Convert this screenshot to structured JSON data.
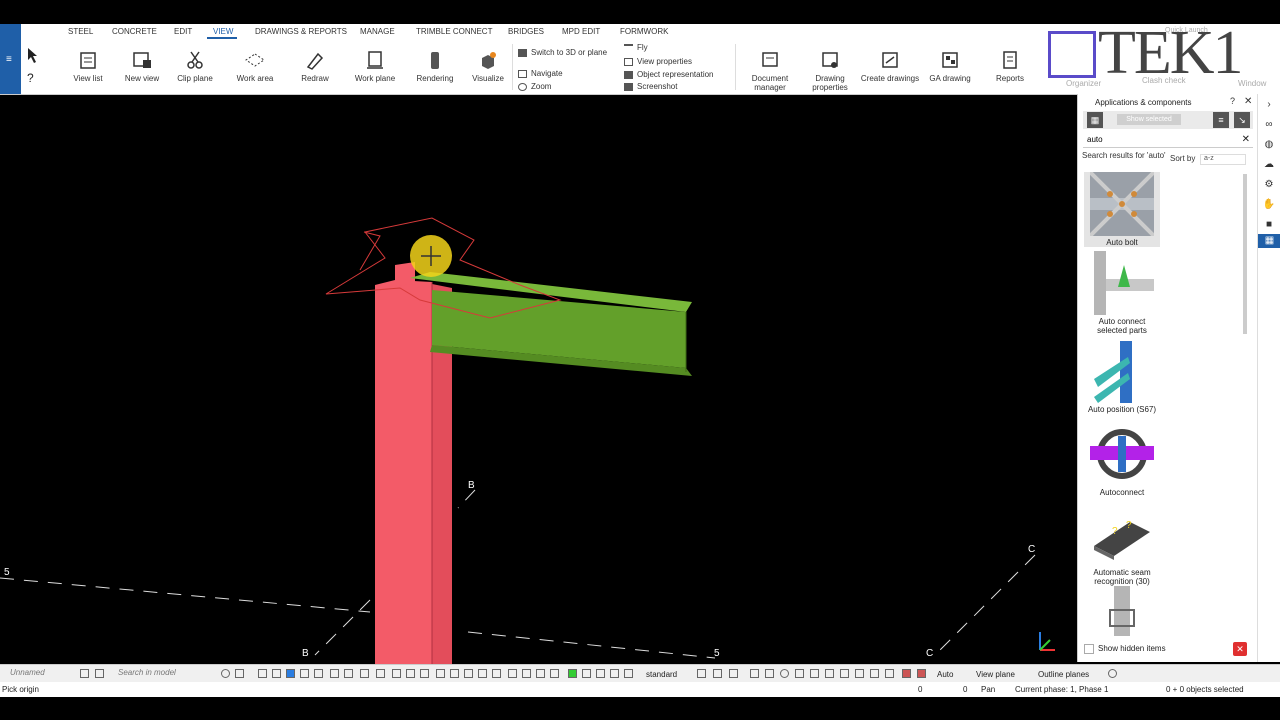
{
  "ribbon_tabs": [
    "STEEL",
    "CONCRETE",
    "EDIT",
    "VIEW",
    "DRAWINGS & REPORTS",
    "MANAGE",
    "TRIMBLE CONNECT",
    "BRIDGES",
    "MPD EDIT",
    "FORMWORK"
  ],
  "active_tab": "VIEW",
  "ribbon_buttons": {
    "view_list": "View list",
    "new_view": "New view",
    "clip_plane": "Clip plane",
    "work_area": "Work area",
    "redraw": "Redraw",
    "work_plane": "Work plane",
    "rendering": "Rendering",
    "visualize": "Visualize",
    "switch_3d": "Switch to 3D or plane",
    "navigate": "Navigate",
    "zoom": "Zoom",
    "fly": "Fly",
    "view_properties": "View properties",
    "object_representation": "Object representation",
    "screenshot": "Screenshot",
    "document_manager": "Document manager",
    "drawing_properties": "Drawing properties",
    "create_drawings": "Create drawings",
    "ga_drawing": "GA drawing",
    "reports": "Reports",
    "organizer": "Organizer",
    "clash_check": "Clash check",
    "window": "Window"
  },
  "quick_launch": "Quick Launch",
  "logo_text": "TEK1",
  "panel": {
    "title": "Applications & components",
    "show_selected": "Show selected",
    "search_value": "auto",
    "results_label": "Search results for 'auto'",
    "sort_label": "Sort by",
    "sort_value": "a-z",
    "components": [
      "Auto bolt",
      "Auto connect selected parts",
      "Auto position (S67)",
      "Autoconnect",
      "Automatic seam recognition (30)"
    ],
    "show_hidden": "Show hidden items"
  },
  "viewport": {
    "grid_labels": [
      "B",
      "5",
      "B",
      "5",
      "C",
      "C"
    ]
  },
  "statusbar": {
    "model_field": "Unnamed",
    "search_placeholder": "Search in model",
    "standard": "standard",
    "auto": "Auto",
    "view_plane": "View plane",
    "outline_planes": "Outline planes",
    "prompt": "Pick origin",
    "coord1": "0",
    "coord2": "0",
    "mode": "Pan",
    "phase": "Current phase: 1, Phase 1",
    "selected": "0 + 0 objects selected"
  },
  "colors": {
    "accent": "#1f5fa8",
    "column": "#f35b68",
    "beam": "#63a02a",
    "highlight": "#f3d31a"
  }
}
